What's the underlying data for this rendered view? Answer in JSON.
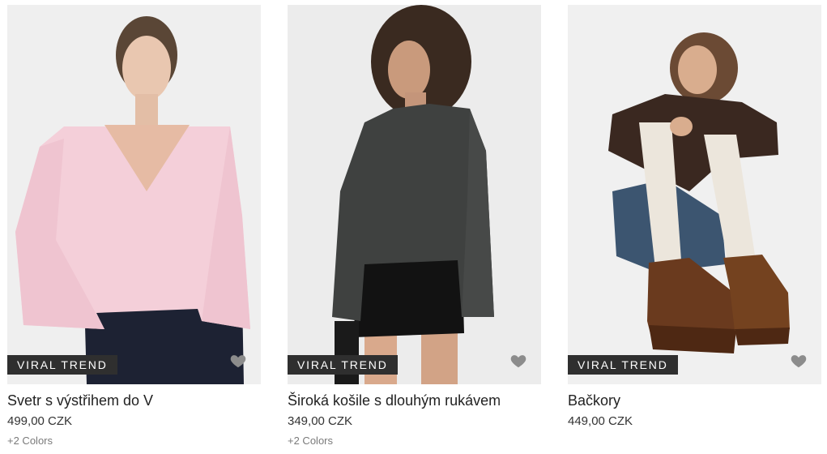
{
  "products": [
    {
      "badge": "VIRAL TREND",
      "name": "Svetr s výstřihem do V",
      "price": "499,00 CZK",
      "colors": "+2 Colors",
      "photo_icon": "pink-v-neck-sweater-model"
    },
    {
      "badge": "VIRAL TREND",
      "name": "Široká košile s dlouhým rukávem",
      "price": "349,00 CZK",
      "colors": "+2 Colors",
      "photo_icon": "grey-wide-top-model"
    },
    {
      "badge": "VIRAL TREND",
      "name": "Bačkory",
      "price": "449,00 CZK",
      "photo_icon": "brown-slippers-model"
    }
  ],
  "theme": {
    "badge_bg": "#2f2f2f",
    "badge_text": "#ffffff",
    "heart_color": "#8c8c8c",
    "photo_bg": "#ededed"
  }
}
